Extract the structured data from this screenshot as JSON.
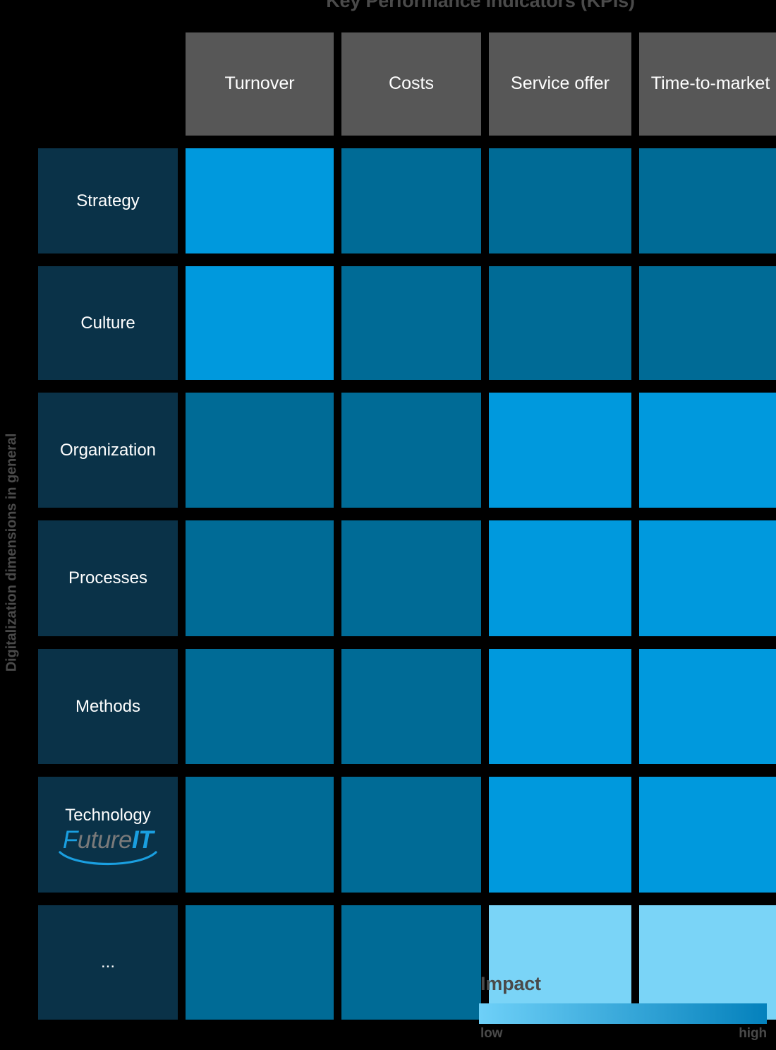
{
  "header": {
    "kpi_title": "Key Performance Indicators (KPIs)",
    "dimensions_title": "Digitalization dimensions in general"
  },
  "logo": {
    "f": "F",
    "uture": "uture",
    "it": "IT",
    "arc_color": "#1a9fe0"
  },
  "legend": {
    "title": "Impact",
    "low_label": "low",
    "high_label": "high",
    "gradient_low": "#6ed0f8",
    "gradient_high": "#0481bc"
  },
  "palette": {
    "column_header_bg": "#575757",
    "row_header_bg": "#0a3248",
    "background": "#000000",
    "impact_low": "#7ad4f7",
    "impact_medium": "#006b96",
    "impact_high": "#0099dd",
    "text_light": "#ffffff",
    "text_gray": "#4a4a4a"
  },
  "chart_data": {
    "type": "heatmap",
    "title": "Key Performance Indicators (KPIs)",
    "xlabel": "Key Performance Indicators (KPIs)",
    "ylabel": "Digitalization dimensions in general",
    "grid": false,
    "legend_position": "bottom-right",
    "columns": [
      "Turnover",
      "Costs",
      "Service offer",
      "Time-to-market"
    ],
    "rows": [
      "Strategy",
      "Culture",
      "Organization",
      "Processes",
      "Methods",
      "Technology",
      "..."
    ],
    "value_scale": {
      "low": 1,
      "medium": 2,
      "high": 3
    },
    "color_scale": {
      "1": "#7ad4f7",
      "2": "#006b96",
      "3": "#0099dd"
    },
    "values": [
      [
        3,
        2,
        2,
        2
      ],
      [
        3,
        2,
        2,
        2
      ],
      [
        2,
        2,
        3,
        3
      ],
      [
        2,
        2,
        3,
        3
      ],
      [
        2,
        2,
        3,
        3
      ],
      [
        2,
        2,
        3,
        3
      ],
      [
        2,
        2,
        1,
        1
      ]
    ],
    "cells": [
      {
        "row": "Strategy",
        "col": "Turnover",
        "impact": "high",
        "color": "#0099dd"
      },
      {
        "row": "Strategy",
        "col": "Costs",
        "impact": "medium",
        "color": "#006b96"
      },
      {
        "row": "Strategy",
        "col": "Service offer",
        "impact": "medium",
        "color": "#006b96"
      },
      {
        "row": "Strategy",
        "col": "Time-to-market",
        "impact": "medium",
        "color": "#006b96"
      },
      {
        "row": "Culture",
        "col": "Turnover",
        "impact": "high",
        "color": "#0099dd"
      },
      {
        "row": "Culture",
        "col": "Costs",
        "impact": "medium",
        "color": "#006b96"
      },
      {
        "row": "Culture",
        "col": "Service offer",
        "impact": "medium",
        "color": "#006b96"
      },
      {
        "row": "Culture",
        "col": "Time-to-market",
        "impact": "medium",
        "color": "#006b96"
      },
      {
        "row": "Organization",
        "col": "Turnover",
        "impact": "medium",
        "color": "#006b96"
      },
      {
        "row": "Organization",
        "col": "Costs",
        "impact": "medium",
        "color": "#006b96"
      },
      {
        "row": "Organization",
        "col": "Service offer",
        "impact": "high",
        "color": "#0099dd"
      },
      {
        "row": "Organization",
        "col": "Time-to-market",
        "impact": "high",
        "color": "#0099dd"
      },
      {
        "row": "Processes",
        "col": "Turnover",
        "impact": "medium",
        "color": "#006b96"
      },
      {
        "row": "Processes",
        "col": "Costs",
        "impact": "medium",
        "color": "#006b96"
      },
      {
        "row": "Processes",
        "col": "Service offer",
        "impact": "high",
        "color": "#0099dd"
      },
      {
        "row": "Processes",
        "col": "Time-to-market",
        "impact": "high",
        "color": "#0099dd"
      },
      {
        "row": "Methods",
        "col": "Turnover",
        "impact": "medium",
        "color": "#006b96"
      },
      {
        "row": "Methods",
        "col": "Costs",
        "impact": "medium",
        "color": "#006b96"
      },
      {
        "row": "Methods",
        "col": "Service offer",
        "impact": "high",
        "color": "#0099dd"
      },
      {
        "row": "Methods",
        "col": "Time-to-market",
        "impact": "high",
        "color": "#0099dd"
      },
      {
        "row": "Technology",
        "col": "Turnover",
        "impact": "medium",
        "color": "#006b96"
      },
      {
        "row": "Technology",
        "col": "Costs",
        "impact": "medium",
        "color": "#006b96"
      },
      {
        "row": "Technology",
        "col": "Service offer",
        "impact": "high",
        "color": "#0099dd"
      },
      {
        "row": "Technology",
        "col": "Time-to-market",
        "impact": "high",
        "color": "#0099dd"
      },
      {
        "row": "...",
        "col": "Turnover",
        "impact": "medium",
        "color": "#006b96"
      },
      {
        "row": "...",
        "col": "Costs",
        "impact": "medium",
        "color": "#006b96"
      },
      {
        "row": "...",
        "col": "Service offer",
        "impact": "low",
        "color": "#7ad4f7"
      },
      {
        "row": "...",
        "col": "Time-to-market",
        "impact": "low",
        "color": "#7ad4f7"
      }
    ]
  }
}
